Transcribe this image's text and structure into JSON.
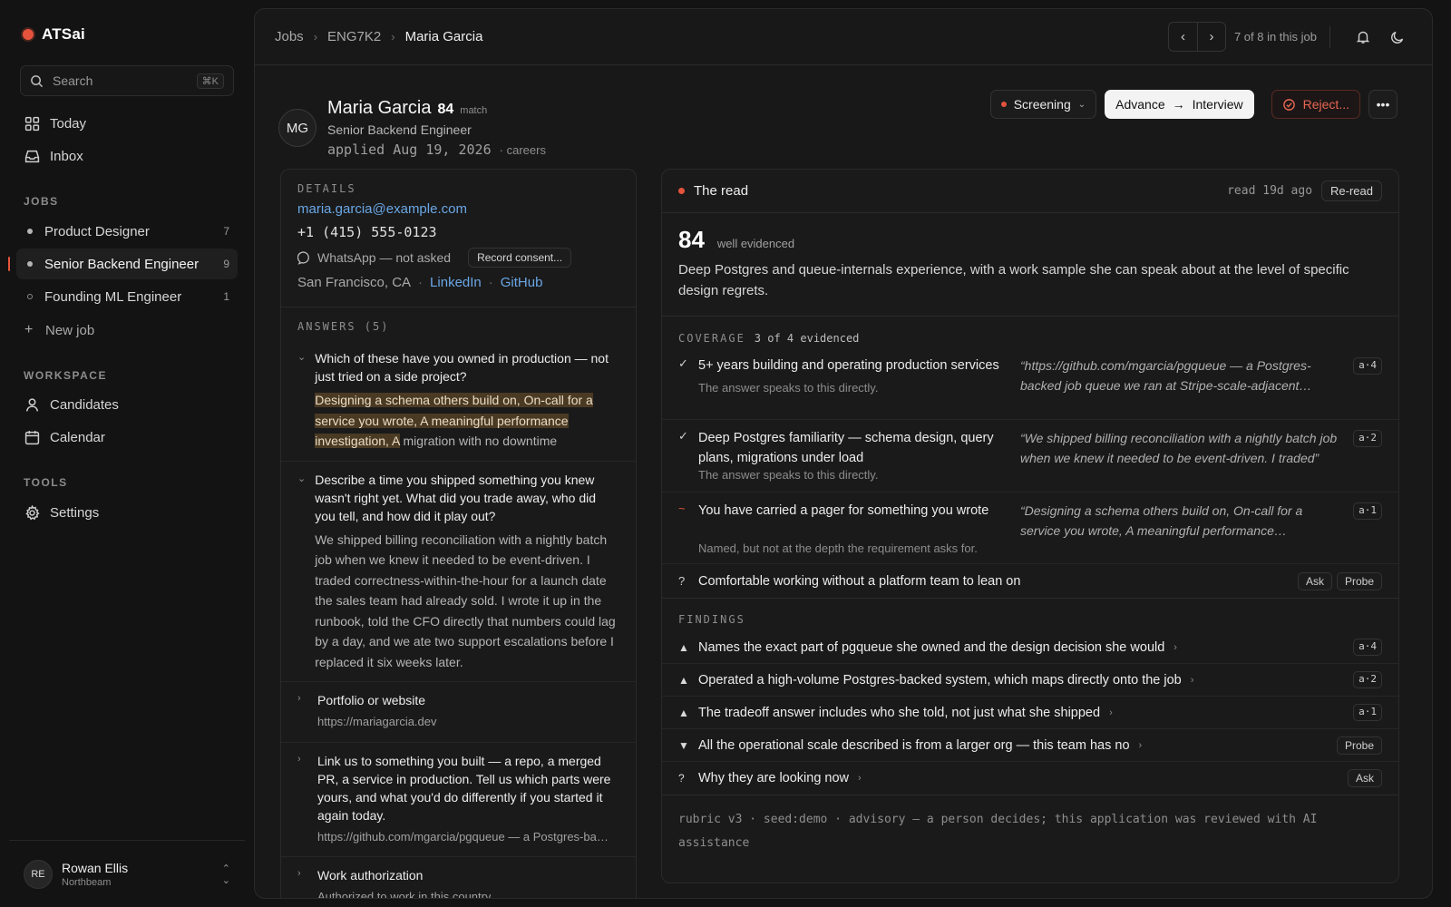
{
  "brand": "ATSai",
  "search": {
    "placeholder": "Search",
    "shortcut": "⌘K"
  },
  "nav": {
    "today": "Today",
    "inbox": "Inbox"
  },
  "jobs_section": "JOBS",
  "jobs": [
    {
      "label": "Product Designer",
      "count": "7"
    },
    {
      "label": "Senior Backend Engineer",
      "count": "9"
    },
    {
      "label": "Founding ML Engineer",
      "count": "1"
    }
  ],
  "new_job": "New job",
  "workspace_section": "WORKSPACE",
  "workspace": {
    "candidates": "Candidates",
    "calendar": "Calendar"
  },
  "tools_section": "TOOLS",
  "tools": {
    "settings": "Settings"
  },
  "user": {
    "initials": "RE",
    "name": "Rowan Ellis",
    "org": "Northbeam"
  },
  "breadcrumb": [
    "Jobs",
    "ENG7K2",
    "Maria Garcia"
  ],
  "pager_text": "7 of 8 in this job",
  "candidate": {
    "initials": "MG",
    "name": "Maria Garcia",
    "score": "84",
    "score_label": "match",
    "role": "Senior Backend Engineer",
    "applied": "applied Aug 19, 2026",
    "source": "careers"
  },
  "actions": {
    "stage": "Screening",
    "advance": "Advance",
    "advance_to": "Interview",
    "reject": "Reject..."
  },
  "details": {
    "label": "DETAILS",
    "email": "maria.garcia@example.com",
    "phone": "+1 (415) 555-0123",
    "whatsapp": "WhatsApp — not asked",
    "consent_button": "Record consent...",
    "location": "San Francisco, CA",
    "linkedin": "LinkedIn",
    "github": "GitHub"
  },
  "answers": {
    "label": "ANSWERS (5)",
    "items": [
      {
        "question": "Which of these have you owned in production — not just tried on a side project?",
        "highlight": "Designing a schema others build on, On-call for a service you wrote, A meaningful performance investigation, A",
        "rest": "migration with no downtime"
      },
      {
        "question": "Describe a time you shipped something you knew wasn't right yet. What did you trade away, who did you tell, and how did it play out?",
        "answer": "We shipped billing reconciliation with a nightly batch job when we knew it needed to be event-driven. I traded correctness-within-the-hour for a launch date the sales team had already sold. I wrote it up in the runbook, told the CFO directly that numbers could lag by a day, and we ate two support escalations before I replaced it six weeks later."
      },
      {
        "question": "Portfolio or website",
        "answer": "https://mariagarcia.dev"
      },
      {
        "question": "Link us to something you built — a repo, a merged PR, a service in production. Tell us which parts were yours, and what you'd do differently if you started it again today.",
        "answer": "https://github.com/mgarcia/pgqueue — a Postgres-backed job queue"
      },
      {
        "question": "Work authorization",
        "answer": "Authorized to work in this country"
      }
    ]
  },
  "read": {
    "title": "The read",
    "ago": "read 19d ago",
    "reread": "Re-read",
    "score": "84",
    "score_note": "well evidenced",
    "summary": "Deep Postgres and queue-internals experience, with a work sample she can speak about at the level of specific design regrets."
  },
  "coverage": {
    "label": "COVERAGE",
    "sub": "3 of 4 evidenced",
    "items": [
      {
        "mark": "✓",
        "title": "5+ years building and operating production services",
        "note": "The answer speaks to this directly.",
        "quote": "“https://github.com/mgarcia/pgqueue — a Postgres-backed job queue we ran at Stripe-scale-adjacent…",
        "tag": "a·4"
      },
      {
        "mark": "✓",
        "title": "Deep Postgres familiarity — schema design, query plans, migrations under load",
        "note": "The answer speaks to this directly.",
        "quote": "“We shipped billing reconciliation with a nightly batch job when we knew it needed to be event-driven. I traded”",
        "tag": "a·2"
      },
      {
        "mark": "~",
        "title": "You have carried a pager for something you wrote",
        "note": "Named, but not at the depth the requirement asks for.",
        "quote": "“Designing a schema others build on, On-call for a service you wrote, A meaningful performance…",
        "tag": "a·1"
      }
    ],
    "open": {
      "mark": "?",
      "title": "Comfortable working without a platform team to lean on",
      "ask": "Ask",
      "probe": "Probe"
    }
  },
  "findings": {
    "label": "FINDINGS",
    "items": [
      {
        "icon": "▲",
        "text": "Names the exact part of pgqueue she owned and the design decision she would",
        "tag": "a·4"
      },
      {
        "icon": "▲",
        "text": "Operated a high-volume Postgres-backed system, which maps directly onto the job",
        "tag": "a·2"
      },
      {
        "icon": "▲",
        "text": "The tradeoff answer includes who she told, not just what she shipped",
        "tag": "a·1"
      },
      {
        "icon": "▼",
        "text": "All the operational scale described is from a larger org — this team has no",
        "button": "Probe"
      },
      {
        "icon": "?",
        "text": "Why they are looking now",
        "button": "Ask"
      }
    ]
  },
  "footer_note": "rubric v3 · seed:demo · advisory — a person decides; this application was reviewed with AI assistance"
}
